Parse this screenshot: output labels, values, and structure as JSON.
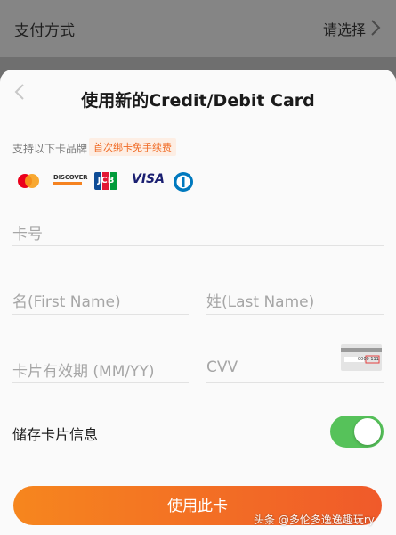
{
  "background": {
    "title": "支付方式",
    "select_label": "请选择"
  },
  "sheet": {
    "title": "使用新的Credit/Debit Card",
    "brands_label": "支持以下卡品牌",
    "fee_badge": "首次绑卡免手续费",
    "brands": [
      "mastercard",
      "discover",
      "jcb",
      "visa",
      "diners"
    ],
    "brand_text": {
      "discover": "DISCOVER",
      "jcb": "JCB",
      "visa": "VISA"
    },
    "fields": {
      "card_number": "卡号",
      "first_name": "名(First Name)",
      "last_name": "姓(Last Name)",
      "expiry": "卡片有效期 (MM/YY)",
      "cvv": "CVV"
    },
    "cvv_card_number": "0000 111",
    "save_card_label": "储存卡片信息",
    "save_card_enabled": true,
    "use_card_button": "使用此卡"
  },
  "watermark": "头条 @多伦多逸逸趣玩ry",
  "colors": {
    "accent": "#f06a24",
    "toggle_on": "#56c25a"
  }
}
